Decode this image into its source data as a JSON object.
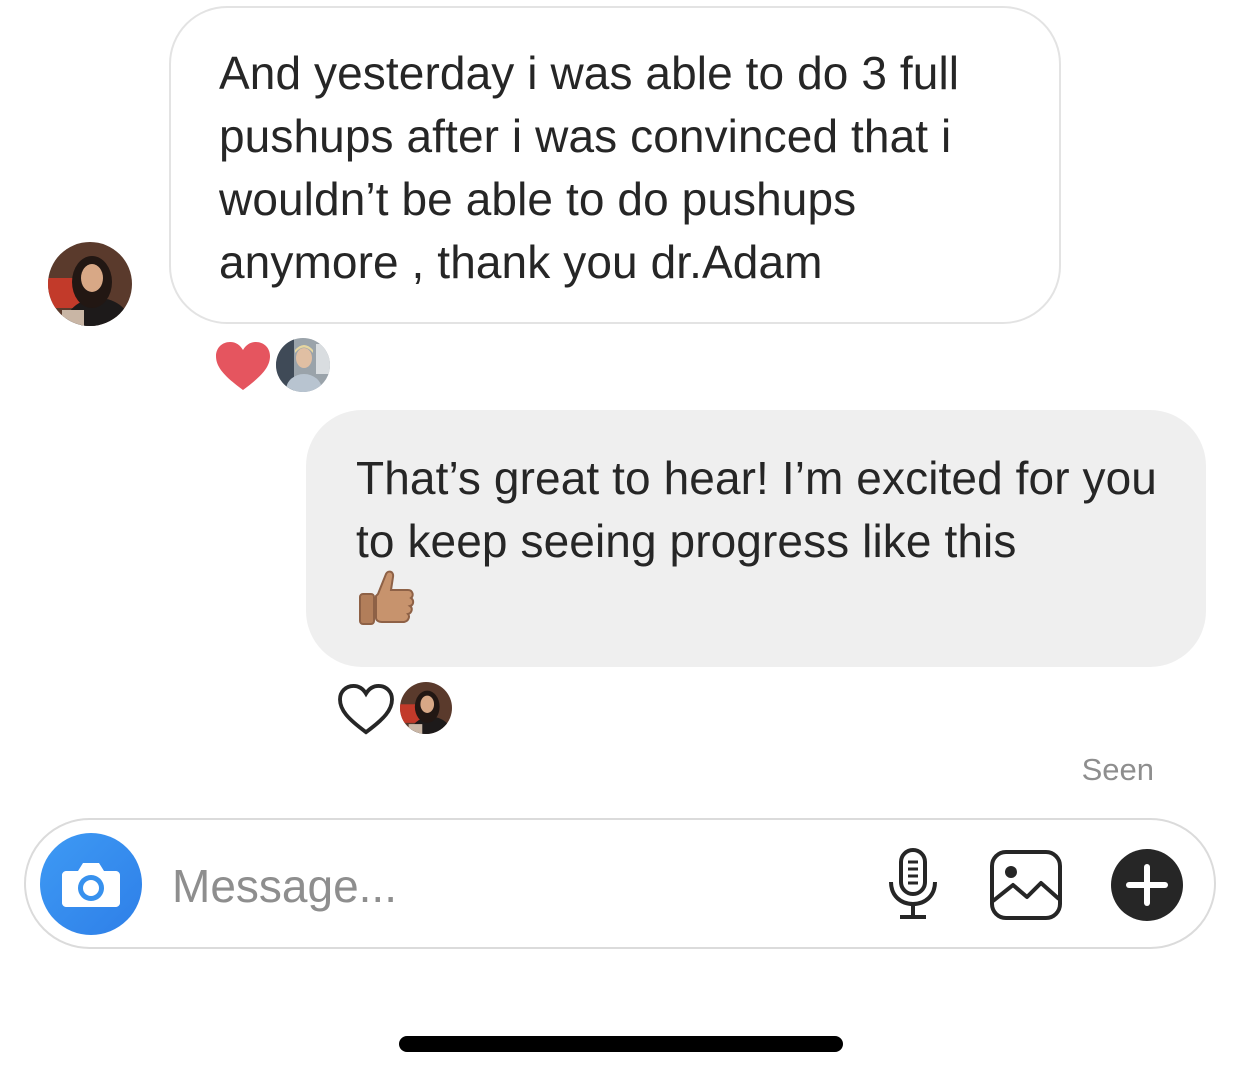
{
  "conversation": {
    "incoming_message": {
      "text": "And yesterday i was able to do 3 full pushups after i was convinced that i wouldn’t be able to do pushups anymore , thank you dr.Adam",
      "reaction_icon": "heart-filled-icon",
      "reaction_color": "#e5555f"
    },
    "outgoing_message": {
      "text": "That’s great to hear! I’m excited for you to keep seeing progress like this",
      "emoji": "👍🏽",
      "reaction_icon": "heart-outline-icon"
    },
    "status": "Seen"
  },
  "composer": {
    "placeholder": "Message...",
    "camera_icon": "camera-icon",
    "mic_icon": "microphone-icon",
    "gallery_icon": "gallery-icon",
    "add_icon": "plus-icon",
    "accent_color": "#3897f0"
  }
}
